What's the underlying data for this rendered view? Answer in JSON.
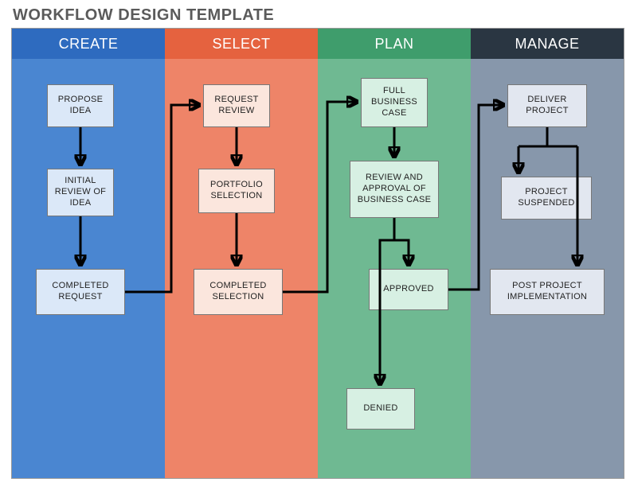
{
  "title": "WORKFLOW DESIGN TEMPLATE",
  "columns": {
    "create": {
      "label": "CREATE"
    },
    "select": {
      "label": "SELECT"
    },
    "plan": {
      "label": "PLAN"
    },
    "manage": {
      "label": "MANAGE"
    }
  },
  "nodes": {
    "propose_idea": "PROPOSE IDEA",
    "initial_review": "INITIAL REVIEW OF IDEA",
    "completed_request": "COMPLETED REQUEST",
    "request_review": "REQUEST REVIEW",
    "portfolio_selection": "PORTFOLIO SELECTION",
    "completed_selection": "COMPLETED SELECTION",
    "full_business_case": "FULL BUSINESS CASE",
    "review_approval": "REVIEW AND APPROVAL OF BUSINESS CASE",
    "approved": "APPROVED",
    "denied": "DENIED",
    "deliver_project": "DELIVER PROJECT",
    "project_suspended": "PROJECT SUSPENDED",
    "post_project_impl": "POST PROJECT IMPLEMENTATION"
  },
  "chart_data": {
    "type": "diagram",
    "title": "WORKFLOW DESIGN TEMPLATE",
    "lanes": [
      {
        "id": "create",
        "label": "CREATE",
        "color": "#4a86d1"
      },
      {
        "id": "select",
        "label": "SELECT",
        "color": "#ee8468"
      },
      {
        "id": "plan",
        "label": "PLAN",
        "color": "#6fb992"
      },
      {
        "id": "manage",
        "label": "MANAGE",
        "color": "#8797ab"
      }
    ],
    "nodes": [
      {
        "id": "propose_idea",
        "lane": "create",
        "label": "PROPOSE IDEA"
      },
      {
        "id": "initial_review",
        "lane": "create",
        "label": "INITIAL REVIEW OF IDEA"
      },
      {
        "id": "completed_request",
        "lane": "create",
        "label": "COMPLETED REQUEST"
      },
      {
        "id": "request_review",
        "lane": "select",
        "label": "REQUEST REVIEW"
      },
      {
        "id": "portfolio_selection",
        "lane": "select",
        "label": "PORTFOLIO SELECTION"
      },
      {
        "id": "completed_selection",
        "lane": "select",
        "label": "COMPLETED SELECTION"
      },
      {
        "id": "full_business_case",
        "lane": "plan",
        "label": "FULL BUSINESS CASE"
      },
      {
        "id": "review_approval",
        "lane": "plan",
        "label": "REVIEW AND APPROVAL OF BUSINESS CASE"
      },
      {
        "id": "approved",
        "lane": "plan",
        "label": "APPROVED"
      },
      {
        "id": "denied",
        "lane": "plan",
        "label": "DENIED"
      },
      {
        "id": "deliver_project",
        "lane": "manage",
        "label": "DELIVER PROJECT"
      },
      {
        "id": "project_suspended",
        "lane": "manage",
        "label": "PROJECT SUSPENDED"
      },
      {
        "id": "post_project_impl",
        "lane": "manage",
        "label": "POST PROJECT IMPLEMENTATION"
      }
    ],
    "edges": [
      {
        "from": "propose_idea",
        "to": "initial_review"
      },
      {
        "from": "initial_review",
        "to": "completed_request"
      },
      {
        "from": "completed_request",
        "to": "request_review"
      },
      {
        "from": "request_review",
        "to": "portfolio_selection"
      },
      {
        "from": "portfolio_selection",
        "to": "completed_selection"
      },
      {
        "from": "completed_selection",
        "to": "full_business_case"
      },
      {
        "from": "full_business_case",
        "to": "review_approval"
      },
      {
        "from": "review_approval",
        "to": "approved"
      },
      {
        "from": "review_approval",
        "to": "denied"
      },
      {
        "from": "approved",
        "to": "deliver_project"
      },
      {
        "from": "deliver_project",
        "to": "project_suspended"
      },
      {
        "from": "deliver_project",
        "to": "post_project_impl"
      }
    ]
  }
}
